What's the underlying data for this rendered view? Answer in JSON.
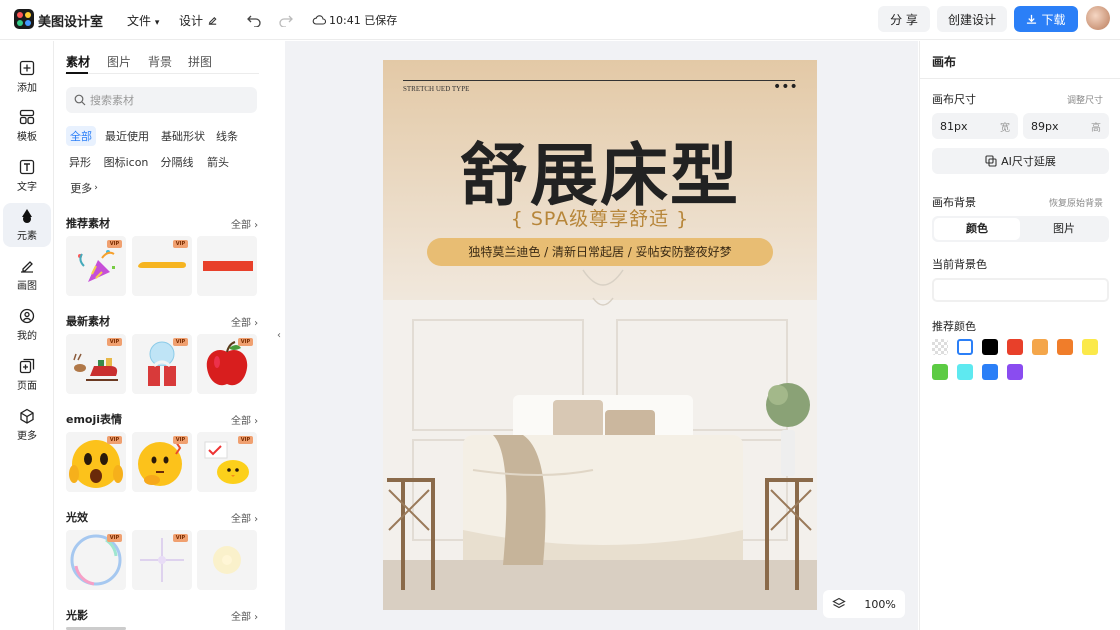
{
  "topbar": {
    "app_name": "美图设计室",
    "menu_file": "文件",
    "menu_design": "设计",
    "save_status": "10:41 已保存",
    "share_label": "分 享",
    "create_label": "创建设计",
    "download_label": "下载"
  },
  "rail": {
    "items": [
      {
        "label": "添加",
        "icon": "plus-square-icon"
      },
      {
        "label": "模板",
        "icon": "layout-icon"
      },
      {
        "label": "文字",
        "icon": "text-icon"
      },
      {
        "label": "元素",
        "icon": "shapes-icon"
      },
      {
        "label": "画图",
        "icon": "pen-icon"
      },
      {
        "label": "我的",
        "icon": "user-icon"
      },
      {
        "label": "页面",
        "icon": "page-add-icon"
      },
      {
        "label": "更多",
        "icon": "cube-icon"
      }
    ]
  },
  "panel": {
    "tabs": [
      "素材",
      "图片",
      "背景",
      "拼图"
    ],
    "search_placeholder": "搜索素材",
    "chips": [
      "全部",
      "最近使用",
      "基础形状",
      "线条",
      "异形",
      "图标icon",
      "分隔线",
      "箭头",
      "更多"
    ],
    "sections": [
      {
        "title": "推荐素材",
        "all": "全部"
      },
      {
        "title": "最新素材",
        "all": "全部"
      },
      {
        "title": "emoji表情",
        "all": "全部"
      },
      {
        "title": "光效",
        "all": "全部"
      },
      {
        "title": "光影",
        "all": "全部"
      }
    ],
    "vip_label": "VIP"
  },
  "poster": {
    "top_text": "STRETCH UED TYPE",
    "title": "舒展床型",
    "subtitle": "{ SPA级尊享舒适 }",
    "tagline": "独特莫兰迪色 / 清新日常起居 / 妥帖安防整夜好梦"
  },
  "zoom": {
    "value": "100%"
  },
  "right": {
    "title": "画布",
    "size_label": "画布尺寸",
    "resize_link": "调整尺寸",
    "width_value": "81px",
    "width_unit": "宽",
    "height_value": "89px",
    "height_unit": "高",
    "ai_extend": "AI尺寸延展",
    "bg_label": "画布背景",
    "restore_link": "恢复原始背景",
    "seg_color": "颜色",
    "seg_image": "图片",
    "current_bg_label": "当前背景色",
    "recommend_label": "推荐颜色",
    "colors": [
      "transparent",
      "#ffffff",
      "#000000",
      "#e8402a",
      "#f4a64b",
      "#f07d2a",
      "#fbe94a",
      "#5ccb43",
      "#5ee9f0",
      "#2b7ff7",
      "#8a4cf0"
    ]
  }
}
